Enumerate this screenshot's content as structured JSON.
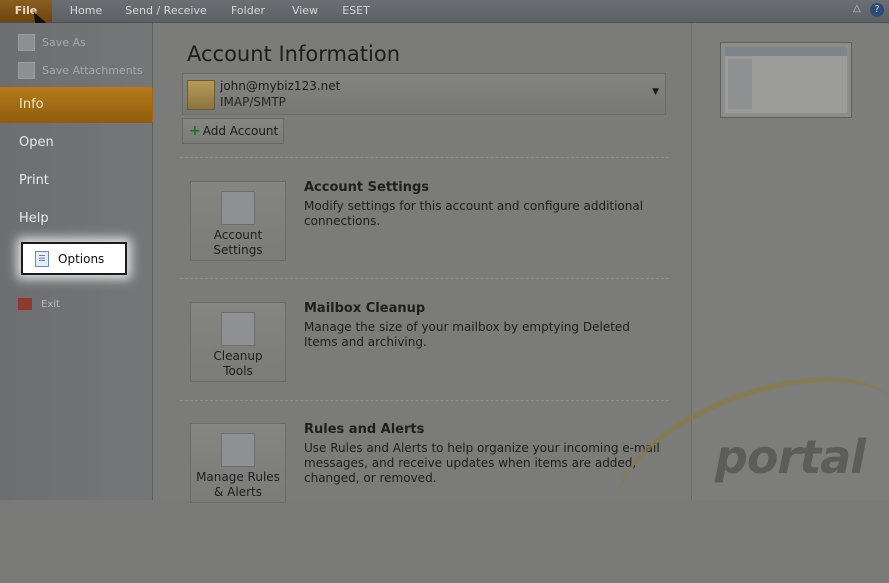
{
  "tabs": [
    "File",
    "Home",
    "Send / Receive",
    "Folder",
    "View",
    "ESET"
  ],
  "nav": {
    "save_as": "Save As",
    "save_attachments": "Save Attachments",
    "info": "Info",
    "open": "Open",
    "print": "Print",
    "help": "Help",
    "options": "Options",
    "exit": "Exit"
  },
  "main": {
    "title": "Account Information",
    "account_email": "john@mybiz123.net",
    "account_type": "IMAP/SMTP",
    "add_account": "Add Account",
    "sections": [
      {
        "button_line1": "Account",
        "button_line2": "Settings",
        "title": "Account Settings",
        "description": "Modify settings for this account and configure additional connections."
      },
      {
        "button_line1": "Cleanup",
        "button_line2": "Tools",
        "title": "Mailbox Cleanup",
        "description": "Manage the size of your mailbox by emptying Deleted Items and archiving."
      },
      {
        "button_line1": "Manage Rules",
        "button_line2": "& Alerts",
        "title": "Rules and Alerts",
        "description": "Use Rules and Alerts to help organize your incoming e-mail messages, and receive updates when items are added, changed, or removed."
      }
    ]
  },
  "watermark": {
    "brand": "portal"
  },
  "colors": {
    "accent": "#b57a19",
    "file_tab": "#8a5e1f"
  }
}
